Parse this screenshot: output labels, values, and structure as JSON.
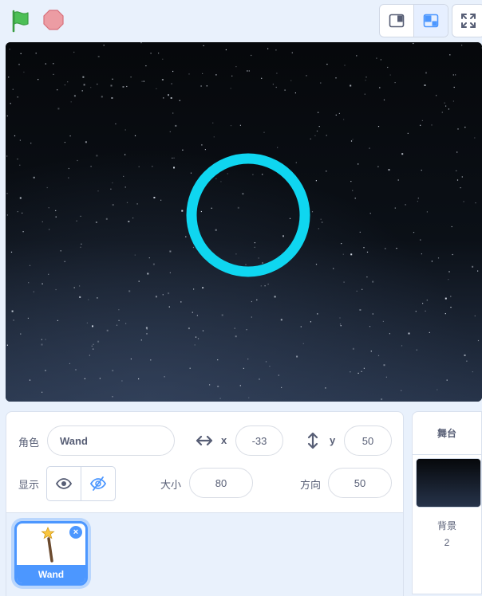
{
  "topbar": {
    "flag_icon": "green-flag-icon",
    "stop_icon": "stop-icon",
    "small_stage_icon": "small-stage-mode-icon",
    "normal_stage_icon": "normal-stage-mode-icon",
    "fullscreen_icon": "fullscreen-icon"
  },
  "sprite_info": {
    "sprite_label": "角色",
    "sprite_name": "Wand",
    "x_label": "x",
    "x_value": "-33",
    "y_label": "y",
    "y_value": "50",
    "show_label": "显示",
    "size_label": "大小",
    "size_value": "80",
    "direction_label": "方向",
    "direction_value": "50"
  },
  "sprites": [
    {
      "name": "Wand",
      "selected": true
    }
  ],
  "stage_panel": {
    "header": "舞台",
    "backdrops_label": "背景",
    "backdrops_count": "2"
  },
  "colors": {
    "accent": "#4c97ff",
    "ring": "#0fd6f0",
    "flag": "#4cbf56",
    "stop": "#ec9ca3"
  }
}
